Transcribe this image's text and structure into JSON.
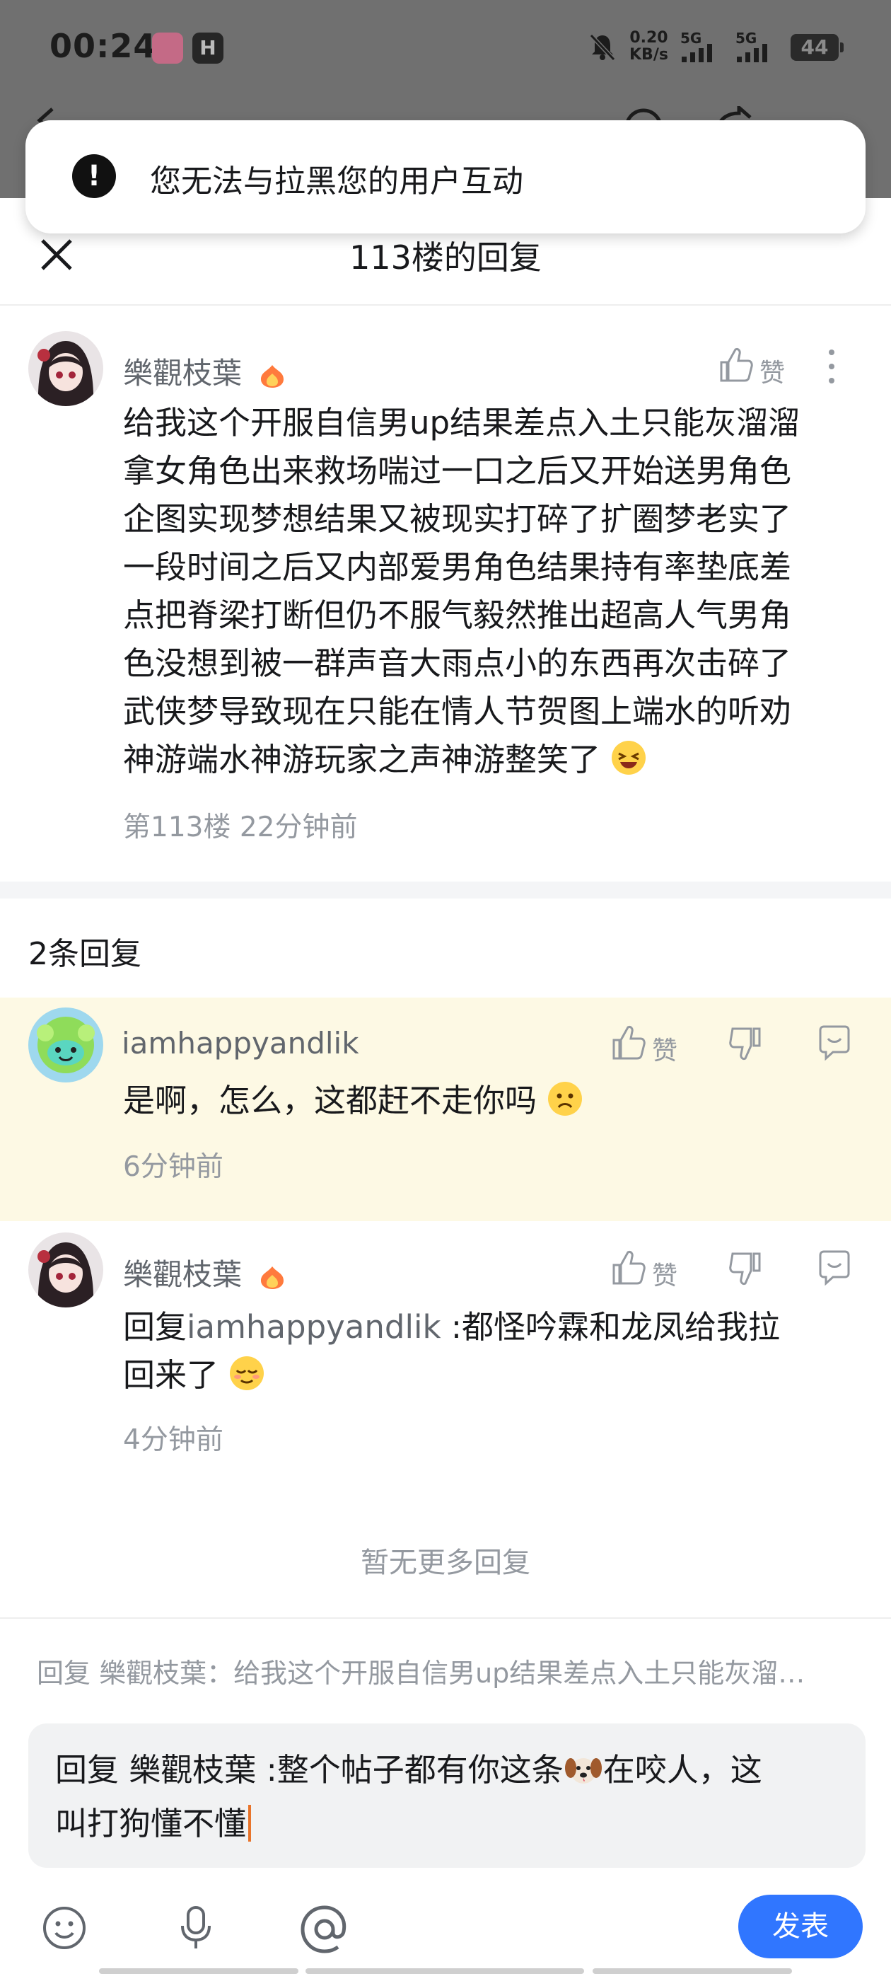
{
  "status_bar": {
    "time": "00:24",
    "speed_value": "0.20",
    "speed_unit": "KB/s",
    "signal_1": "5G",
    "signal_2": "5G",
    "battery": "44"
  },
  "toast": {
    "message": "您无法与拉黑您的用户互动"
  },
  "sheet": {
    "title": "113楼的回复"
  },
  "main_comment": {
    "username": "樂觀枝葉",
    "like_label": "赞",
    "lines": [
      "给我这个开服自信男up结果差点入土只能灰溜溜",
      "拿女角色出来救场喘过一口之后又开始送男角色",
      "企图实现梦想结果又被现实打碎了扩圈梦老实了",
      "一段时间之后又内部爱男角色结果持有率垫底差",
      "点把脊梁打断但仍不服气毅然推出超高人气男角",
      "色没想到被一群声音大雨点小的东西再次击碎了",
      "武侠梦导致现在只能在情人节贺图上端水的听劝",
      "神游端水神游玩家之声神游整笑了"
    ],
    "meta": "第113楼 22分钟前"
  },
  "replies_count": "2条回复",
  "replies": [
    {
      "username": "iamhappyandlik",
      "like_label": "赞",
      "text": "是啊，怎么，这都赶不走你吗",
      "time": "6分钟前"
    },
    {
      "username": "樂觀枝葉",
      "like_label": "赞",
      "reply_prefix": "回复",
      "reply_to": "iamhappyandlik",
      "text_line1": ":都怪吟霖和龙凤给我拉",
      "text_line2": "回来了",
      "time": "4分钟前"
    }
  ],
  "no_more": "暂无更多回复",
  "composer": {
    "reply_target": "回复 樂觀枝葉：给我这个开服自信男up结果差点入土只能灰溜…",
    "input_line1_a": "回复 樂觀枝葉 :整个帖子都有你这条",
    "input_line1_b": "在咬人，这",
    "input_line2": "叫打狗懂不懂",
    "send_label": "发表"
  },
  "colors": {
    "accent": "#3076ff",
    "highlight_bg": "#fdf9e4",
    "caret": "#e8742a"
  }
}
